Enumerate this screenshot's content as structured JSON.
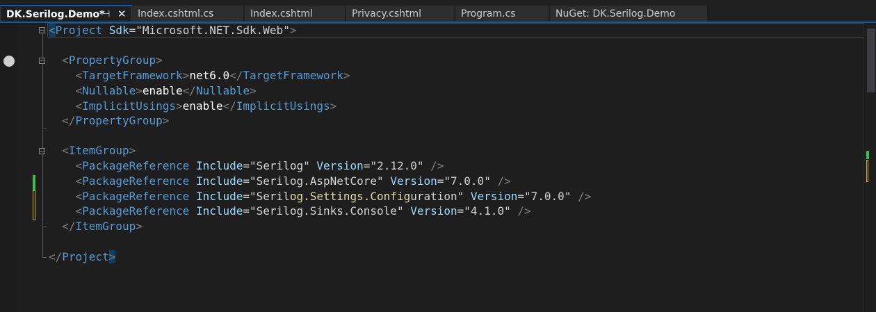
{
  "tabs": [
    {
      "label": "DK.Serilog.Demo*",
      "active": true,
      "pin_icon": "pin-icon",
      "close_icon": "close-icon"
    },
    {
      "label": "Index.cshtml.cs"
    },
    {
      "label": "Index.cshtml"
    },
    {
      "label": "Privacy.cshtml"
    },
    {
      "label": "Program.cs"
    },
    {
      "label": "NuGet: DK.Serilog.Demo"
    }
  ],
  "colors": {
    "accent": "#005fb8",
    "tag": "#569cd6",
    "attribute": "#9cdcfe",
    "delimiter": "#808080",
    "text": "#ffffff",
    "highlight": "#dcdcaa",
    "added_change": "#3fb950",
    "saved_change": "#c9b635"
  },
  "code": {
    "project_open_tag": "Project",
    "sdk_attr": "Sdk",
    "sdk_value": "\"Microsoft.NET.Sdk.Web\"",
    "property_group": "PropertyGroup",
    "target_framework": "TargetFramework",
    "target_framework_value": "net6.0",
    "nullable": "Nullable",
    "nullable_value": "enable",
    "implicit_usings": "ImplicitUsings",
    "implicit_usings_value": "enable",
    "item_group": "ItemGroup",
    "package_reference": "PackageReference",
    "include_attr": "Include",
    "version_attr": "Version",
    "packages": [
      {
        "include": "\"Serilog\"",
        "version": "\"2.12.0\""
      },
      {
        "include": "\"Serilog.AspNetCore\"",
        "version": "\"7.0.0\""
      },
      {
        "include_pre": "\"Seril",
        "include_hl": "og.Settings.Config",
        "include_post": "uration\"",
        "version": "\"7.0.0\""
      },
      {
        "include": "\"Serilog.Sinks.Console\"",
        "version": "\"4.1.0\""
      }
    ],
    "project_close_tag": "Project"
  }
}
